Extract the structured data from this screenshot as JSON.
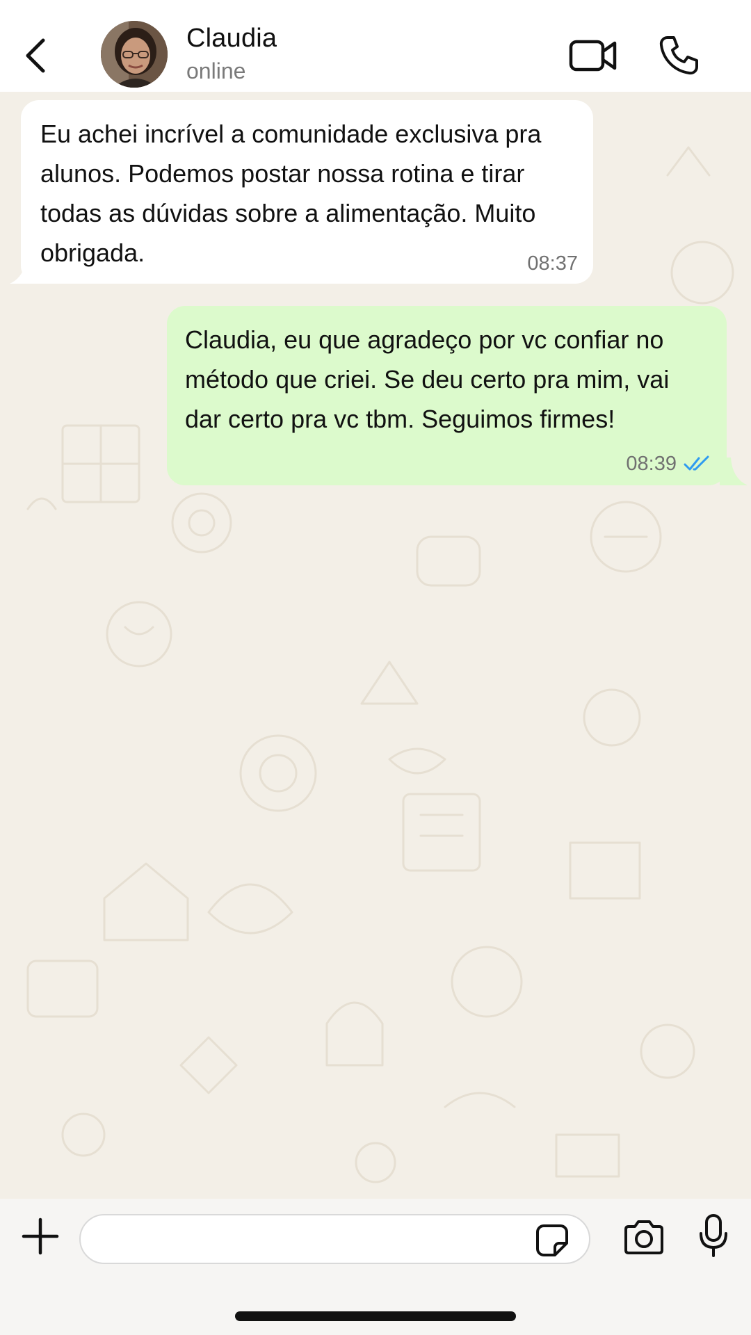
{
  "header": {
    "contact_name": "Claudia",
    "status": "online"
  },
  "messages": [
    {
      "direction": "incoming",
      "text": "Eu achei incrível a comunidade exclusiva pra alunos. Podemos postar nossa rotina e tirar todas as dúvidas sobre a alimentação. Muito obrigada.",
      "time": "08:37"
    },
    {
      "direction": "outgoing",
      "text": "Claudia, eu que agradeço por vc confiar no método que criei. Se deu certo pra mim, vai dar certo pra vc tbm. Seguimos firmes!",
      "time": "08:39",
      "status_icon": "double-check-read-icon"
    }
  ],
  "composer": {
    "value": "",
    "placeholder": ""
  },
  "icons": {
    "back": "chevron-left-icon",
    "video": "video-camera-icon",
    "call": "phone-icon",
    "plus": "plus-icon",
    "sticker": "sticker-icon",
    "camera": "camera-icon",
    "mic": "microphone-icon"
  },
  "colors": {
    "incoming_bubble": "#ffffff",
    "outgoing_bubble": "#dcfacc",
    "read_ticks": "#2f9bf0",
    "wallpaper": "#f3efe7"
  }
}
